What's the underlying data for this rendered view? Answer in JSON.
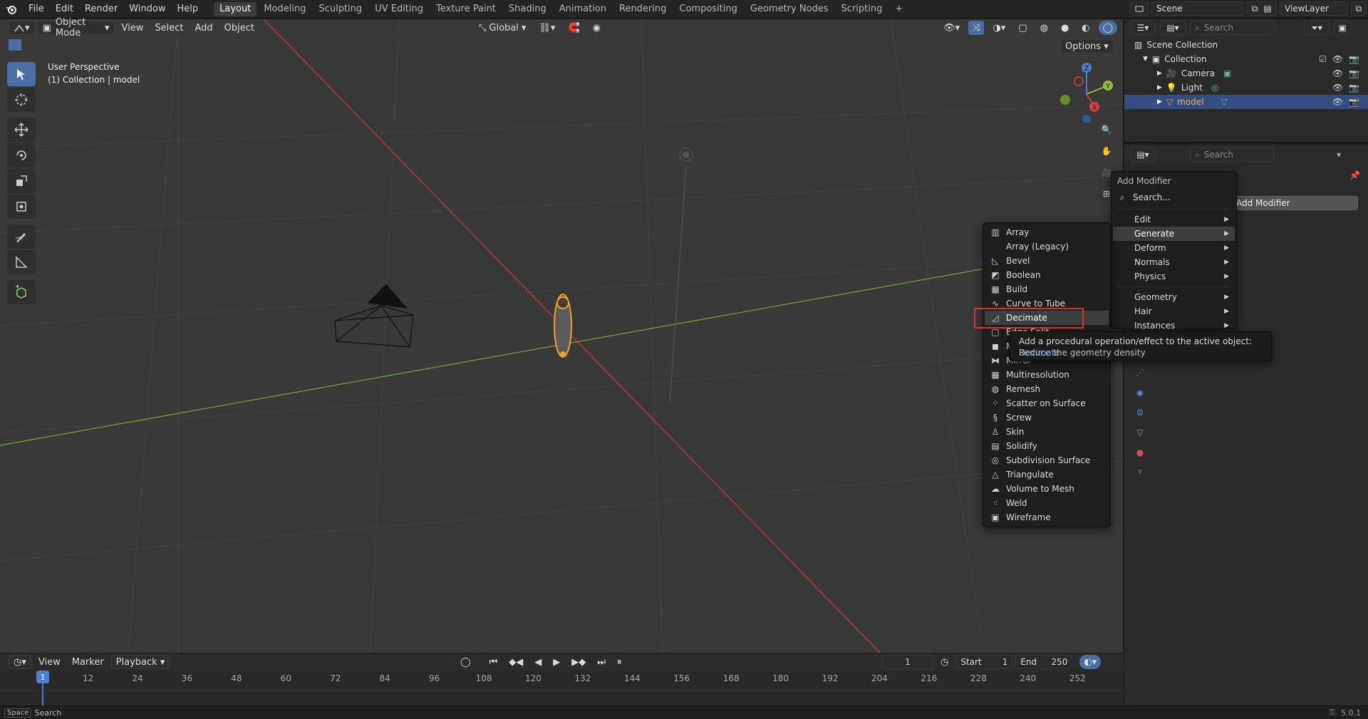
{
  "topbar": {
    "menus": [
      "File",
      "Edit",
      "Render",
      "Window",
      "Help"
    ],
    "workspaces": [
      "Layout",
      "Modeling",
      "Sculpting",
      "UV Editing",
      "Texture Paint",
      "Shading",
      "Animation",
      "Rendering",
      "Compositing",
      "Geometry Nodes",
      "Scripting"
    ],
    "active_workspace": "Layout",
    "add_tab": "+",
    "scene_label": "Scene",
    "viewlayer_label": "ViewLayer"
  },
  "viewport": {
    "mode": "Object Mode",
    "menus": [
      "View",
      "Select",
      "Add",
      "Object"
    ],
    "transform_orientation": "Global",
    "options_label": "Options",
    "overlay_title": "User Perspective",
    "overlay_subtitle": "(1) Collection | model",
    "axis_labels": {
      "x": "X",
      "y": "Y",
      "z": "Z"
    }
  },
  "outliner": {
    "search_placeholder": "Search",
    "root": "Scene Collection",
    "collection": "Collection",
    "items": [
      {
        "label": "Camera",
        "icon": "camera-icon",
        "selected": false
      },
      {
        "label": "Light",
        "icon": "light-icon",
        "selected": false
      },
      {
        "label": "model",
        "icon": "mesh-icon",
        "selected": true
      }
    ]
  },
  "properties": {
    "search_placeholder": "Search",
    "add_modifier_button": "Add Modifier"
  },
  "add_modifier_menu": {
    "title": "Add Modifier",
    "search_placeholder": "Search...",
    "categories": [
      {
        "label": "Edit",
        "highlight": false
      },
      {
        "label": "Generate",
        "highlight": true
      },
      {
        "label": "Deform",
        "highlight": false
      },
      {
        "label": "Normals",
        "highlight": false
      },
      {
        "label": "Physics",
        "highlight": false
      }
    ],
    "categories2": [
      {
        "label": "Geometry"
      },
      {
        "label": "Hair"
      },
      {
        "label": "Instances"
      }
    ]
  },
  "generate_menu": {
    "items": [
      {
        "label": "Array",
        "icon": "array-icon"
      },
      {
        "label": "Array (Legacy)",
        "icon": ""
      },
      {
        "label": "Bevel",
        "icon": "bevel-icon"
      },
      {
        "label": "Boolean",
        "icon": "boolean-icon"
      },
      {
        "label": "Build",
        "icon": "build-icon"
      },
      {
        "label": "Curve to Tube",
        "icon": "curve-icon"
      },
      {
        "label": "Decimate",
        "icon": "decimate-icon"
      },
      {
        "label": "Edge Split",
        "icon": "edge-split-icon"
      },
      {
        "label": "Mask",
        "icon": "mask-icon"
      },
      {
        "label": "Mirror",
        "icon": "mirror-icon"
      },
      {
        "label": "Multiresolution",
        "icon": "multires-icon"
      },
      {
        "label": "Remesh",
        "icon": "remesh-icon"
      },
      {
        "label": "Scatter on Surface",
        "icon": "scatter-icon"
      },
      {
        "label": "Screw",
        "icon": "screw-icon"
      },
      {
        "label": "Skin",
        "icon": "skin-icon"
      },
      {
        "label": "Solidify",
        "icon": "solidify-icon"
      },
      {
        "label": "Subdivision Surface",
        "icon": "subsurf-icon"
      },
      {
        "label": "Triangulate",
        "icon": "triangulate-icon"
      },
      {
        "label": "Volume to Mesh",
        "icon": "volume-icon"
      },
      {
        "label": "Weld",
        "icon": "weld-icon"
      },
      {
        "label": "Wireframe",
        "icon": "wireframe-icon"
      }
    ],
    "highlighted": "Decimate"
  },
  "tooltip": {
    "text": "Add a procedural operation/effect to the active object:",
    "link": "Decimate",
    "description": "Reduce the geometry density"
  },
  "timeline": {
    "menus": [
      "View",
      "Marker",
      "Playback"
    ],
    "current_frame": "1",
    "start_label": "Start",
    "start_value": "1",
    "end_label": "End",
    "end_value": "250",
    "ticks": [
      "1",
      "12",
      "24",
      "36",
      "48",
      "60",
      "72",
      "84",
      "96",
      "108",
      "120",
      "132",
      "144",
      "156",
      "168",
      "180",
      "192",
      "204",
      "216",
      "228",
      "240",
      "252"
    ]
  },
  "statusbar": {
    "key": "Space",
    "action": "Search",
    "version": "5.0.1"
  },
  "colors": {
    "accent": "#4b6ea5",
    "selection": "#334d80",
    "highlight_box": "#e03030",
    "object_outline": "#f0a030",
    "x_axis": "#b83838",
    "y_axis": "#6f9a2f"
  }
}
